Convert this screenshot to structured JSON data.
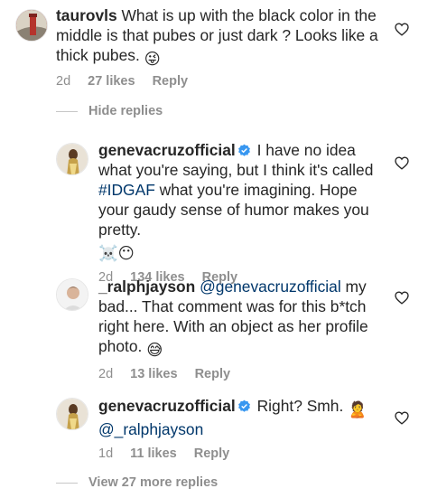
{
  "comments": [
    {
      "username": "taurovls",
      "text": "What is up with the black color in the middle is that pubes or just dark ? Looks like a thick pubes.",
      "emoji": "😜",
      "time": "2d",
      "likes": "27 likes",
      "reply": "Reply"
    },
    {
      "username": "genevacruzofficial",
      "verified": true,
      "text_before": "I have no idea what you're saying, but I think it's called",
      "hashtag": "#IDGAF",
      "text_after": "what you're imagining. Hope your gaudy sense of humor makes you pretty.",
      "emoji": "☠️😶",
      "time": "2d",
      "likes": "134 likes",
      "reply": "Reply"
    },
    {
      "username": "_ralphjayson",
      "mention": "@genevacruzofficial",
      "text": "my bad... That comment was for this b*tch right here. With an object as her profile photo.",
      "emoji": "😅",
      "time": "2d",
      "likes": "13 likes",
      "reply": "Reply"
    },
    {
      "username": "genevacruzofficial",
      "verified": true,
      "text": "Right? Smh.",
      "emoji": "🙎",
      "mention": "@_ralphjayson",
      "time": "1d",
      "likes": "11 likes",
      "reply": "Reply"
    }
  ],
  "hide_replies": "Hide replies",
  "view_more": "View 27 more replies",
  "colors": {
    "text": "#262626",
    "meta": "#8e8e8e",
    "mention": "#00376b",
    "verified": "#3897f0"
  }
}
